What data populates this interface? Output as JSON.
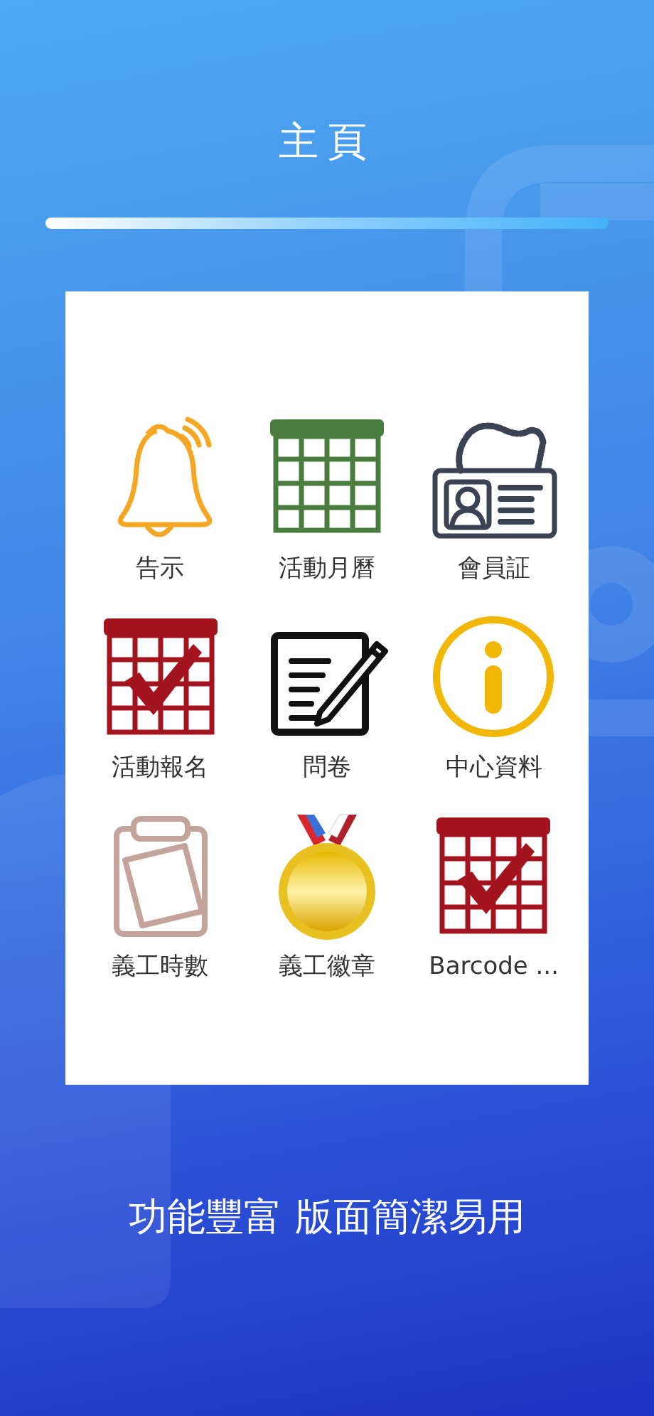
{
  "header": {
    "title": "主頁"
  },
  "menu": [
    {
      "label": "告示"
    },
    {
      "label": "活動月曆"
    },
    {
      "label": "會員証"
    },
    {
      "label": "活動報名"
    },
    {
      "label": "問卷"
    },
    {
      "label": "中心資料"
    },
    {
      "label": "義工時數"
    },
    {
      "label": "義工徽章"
    },
    {
      "label": "Barcode ..."
    }
  ],
  "tagline": "功能豐富 版面簡潔易用"
}
